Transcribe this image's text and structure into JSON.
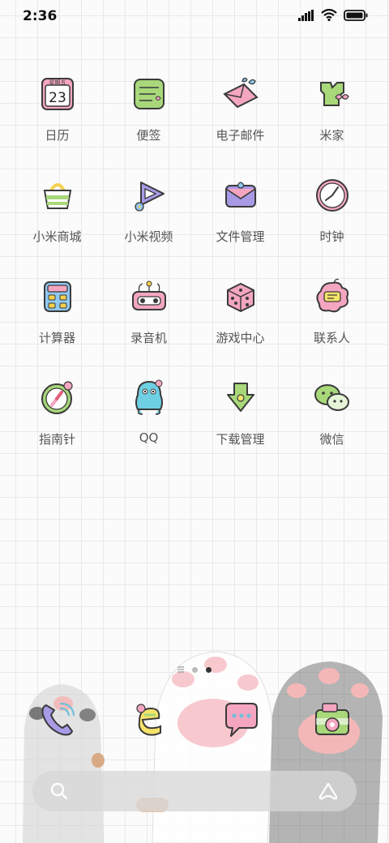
{
  "status_bar": {
    "time": "2:36",
    "icons": [
      "signal-icon",
      "wifi-icon",
      "battery-icon"
    ]
  },
  "apps": [
    {
      "label": "日历",
      "icon": "calendar-icon",
      "calendar_weekday": "星期五",
      "calendar_day": "23"
    },
    {
      "label": "便签",
      "icon": "notes-icon"
    },
    {
      "label": "电子邮件",
      "icon": "email-icon"
    },
    {
      "label": "米家",
      "icon": "mijia-icon"
    },
    {
      "label": "小米商城",
      "icon": "mi-store-icon"
    },
    {
      "label": "小米视频",
      "icon": "mi-video-icon"
    },
    {
      "label": "文件管理",
      "icon": "file-manager-icon"
    },
    {
      "label": "时钟",
      "icon": "clock-icon"
    },
    {
      "label": "计算器",
      "icon": "calculator-icon"
    },
    {
      "label": "录音机",
      "icon": "recorder-icon"
    },
    {
      "label": "游戏中心",
      "icon": "game-center-icon"
    },
    {
      "label": "联系人",
      "icon": "contacts-icon"
    },
    {
      "label": "指南针",
      "icon": "compass-icon"
    },
    {
      "label": "QQ",
      "icon": "qq-icon"
    },
    {
      "label": "下载管理",
      "icon": "download-manager-icon"
    },
    {
      "label": "微信",
      "icon": "wechat-icon"
    }
  ],
  "page_indicator": {
    "pages": 2,
    "current": 2
  },
  "dock": [
    {
      "icon": "phone-icon"
    },
    {
      "icon": "browser-icon"
    },
    {
      "icon": "messages-icon"
    },
    {
      "icon": "camera-icon"
    }
  ],
  "search_bar": {
    "left_icon": "search-icon",
    "right_icon": "assistant-icon"
  },
  "colors": {
    "grid_line": "#e9e9e9",
    "pink": "#f4a6c0",
    "green": "#a8d87a",
    "blue": "#8fc8f0",
    "purple": "#a99ae6",
    "outline": "#3a3a3a"
  }
}
